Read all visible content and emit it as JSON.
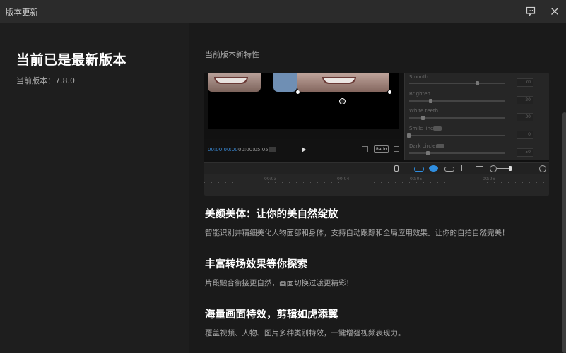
{
  "window": {
    "title": "版本更新"
  },
  "left": {
    "heading": "当前已是最新版本",
    "version_label": "当前版本：7.8.0"
  },
  "main": {
    "section_label": "当前版本新特性",
    "screenshot": {
      "time_current": "00:00:00:00",
      "time_total": "00:00:05:05",
      "ratio_label": "Ratio",
      "adjust_labels": [
        "Smooth",
        "Brighten",
        "White teeth",
        "Smile lines",
        "Dark circles"
      ],
      "adjust_values": [
        "70",
        "20",
        "30",
        "0",
        "50"
      ],
      "adjust_levels": [
        0.7,
        0.2,
        0.3,
        0.0,
        0.5
      ],
      "ruler_ticks": [
        "00:03",
        "00:04",
        "00:05",
        "00:06"
      ]
    },
    "features": [
      {
        "title": "美颜美体：让你的美自然绽放",
        "desc": "智能识别并精细美化人物面部和身体，支持自动跟踪和全局应用效果。让你的自拍自然完美！"
      },
      {
        "title": "丰富转场效果等你探索",
        "desc": "片段融合衔接更自然，画面切换过渡更精彩！"
      },
      {
        "title": "海量画面特效，剪辑如虎添翼",
        "desc": "覆盖视频、人物、图片多种类别特效，一键增强视频表现力。"
      }
    ]
  },
  "colors": {
    "accent": "#2f8ee0",
    "background": "#1c1c1c",
    "titlebar": "#2b2b2b"
  }
}
